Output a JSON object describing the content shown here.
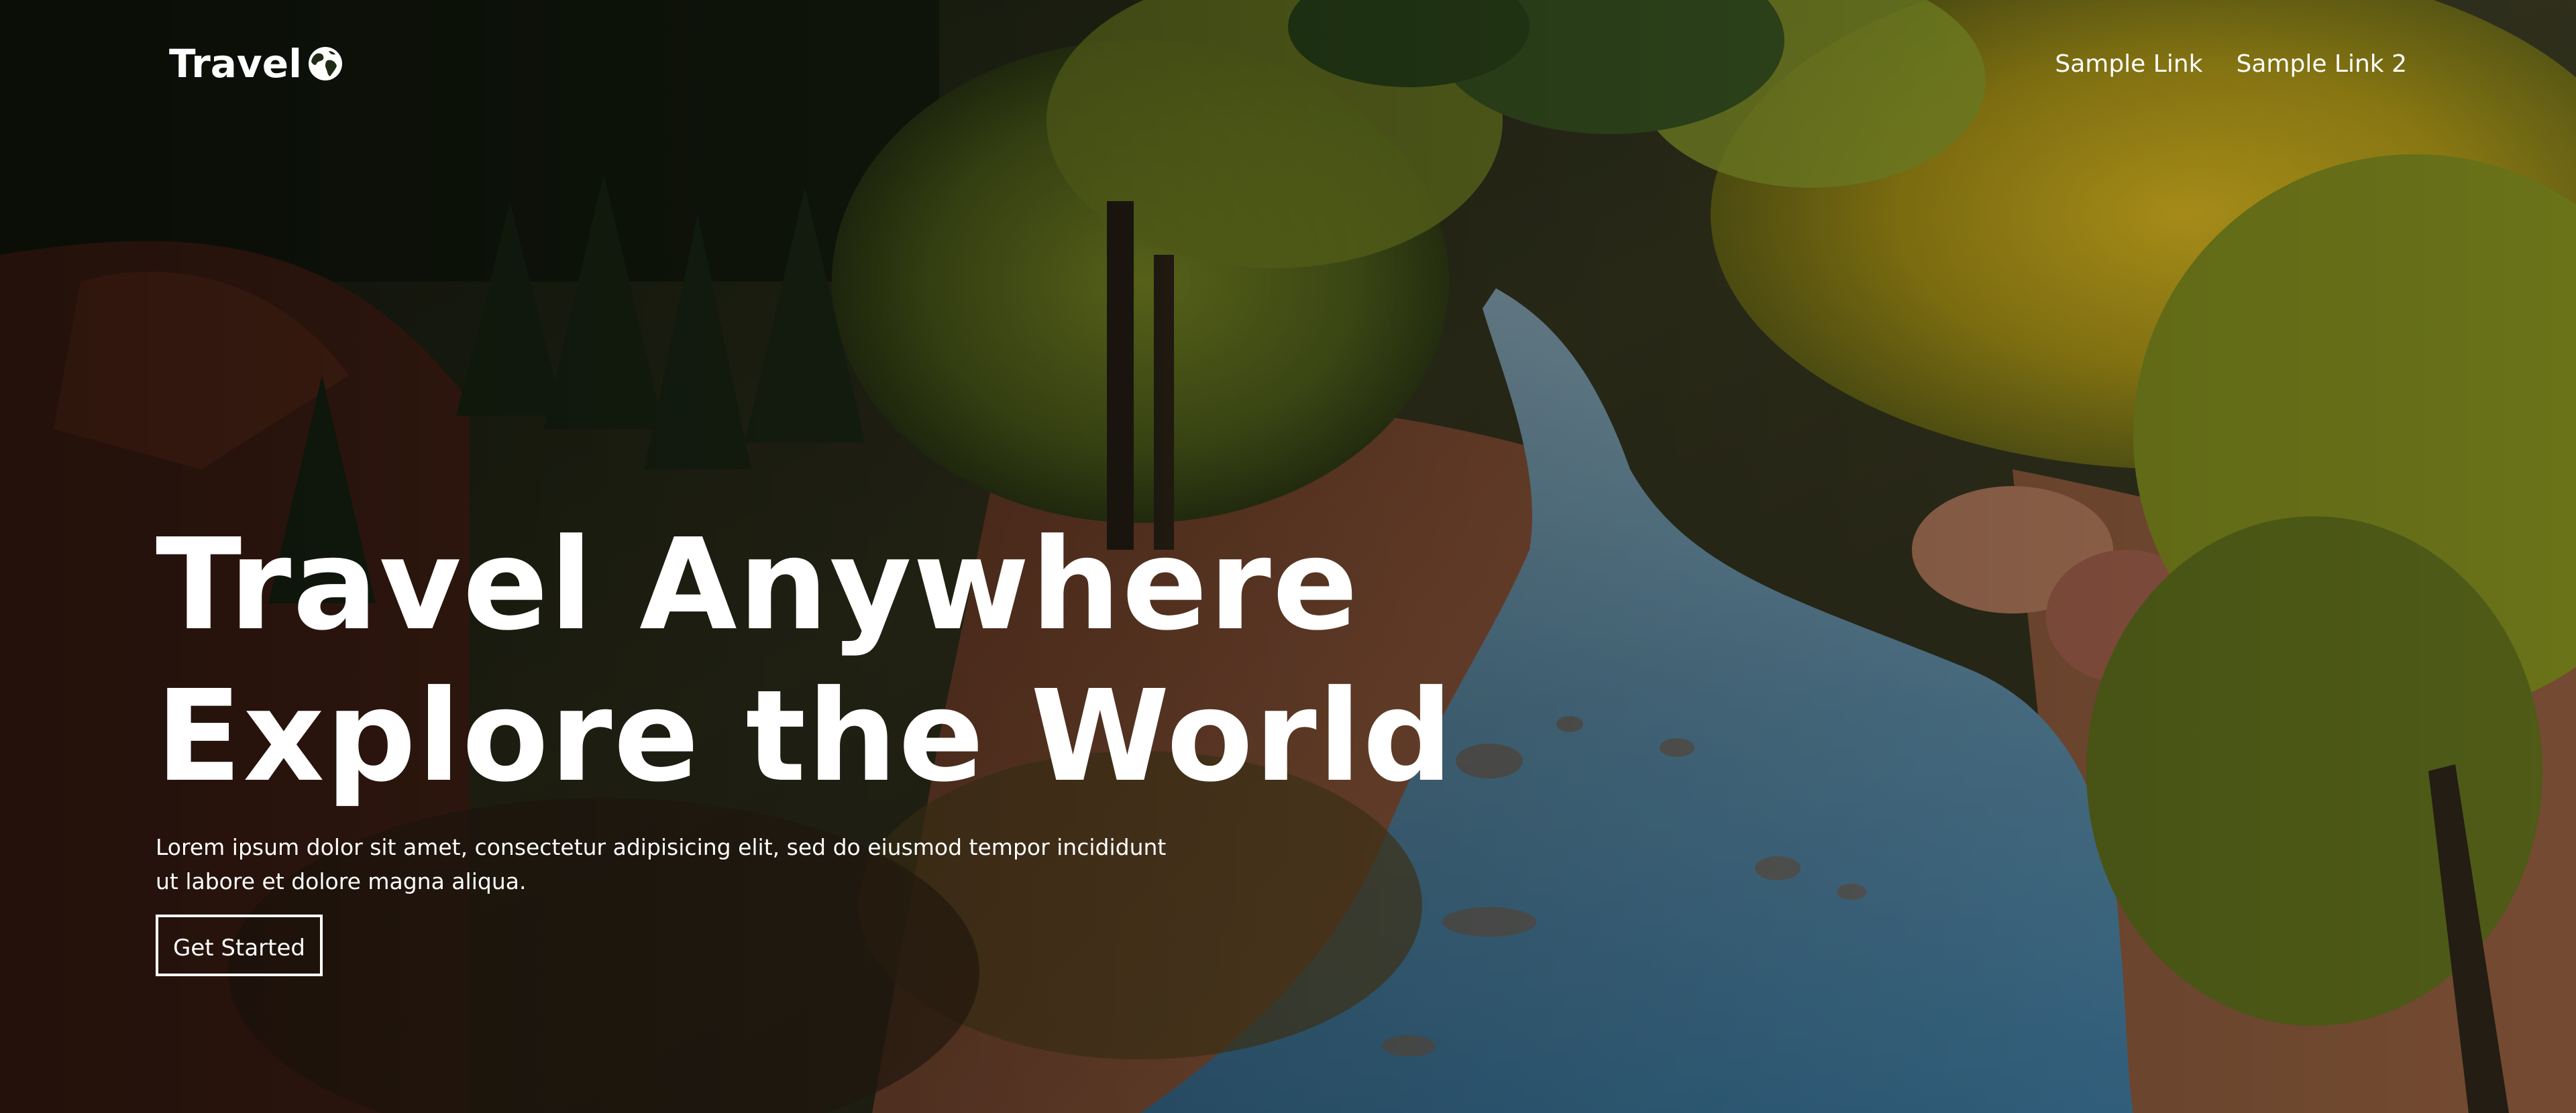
{
  "brand": {
    "name": "Travel",
    "icon": "globe-icon"
  },
  "nav": {
    "links": [
      {
        "label": "Sample Link"
      },
      {
        "label": "Sample Link 2"
      }
    ]
  },
  "hero": {
    "headline_line1": "Travel Anywhere",
    "headline_line2": "Explore the World",
    "lead": "Lorem ipsum dolor sit amet, consectetur adipisicing elit, sed do eiusmod tempor incididunt ut labore et dolore magna aliqua.",
    "cta_label": "Get Started",
    "background": "forest-river-canyon-photo"
  },
  "colors": {
    "text": "#ffffff",
    "overlay": "#000000",
    "river": "#5f8ea8",
    "foliage_yellow": "#b39a1c",
    "foliage_green": "#3d5a22",
    "soil": "#8a4a2a"
  }
}
